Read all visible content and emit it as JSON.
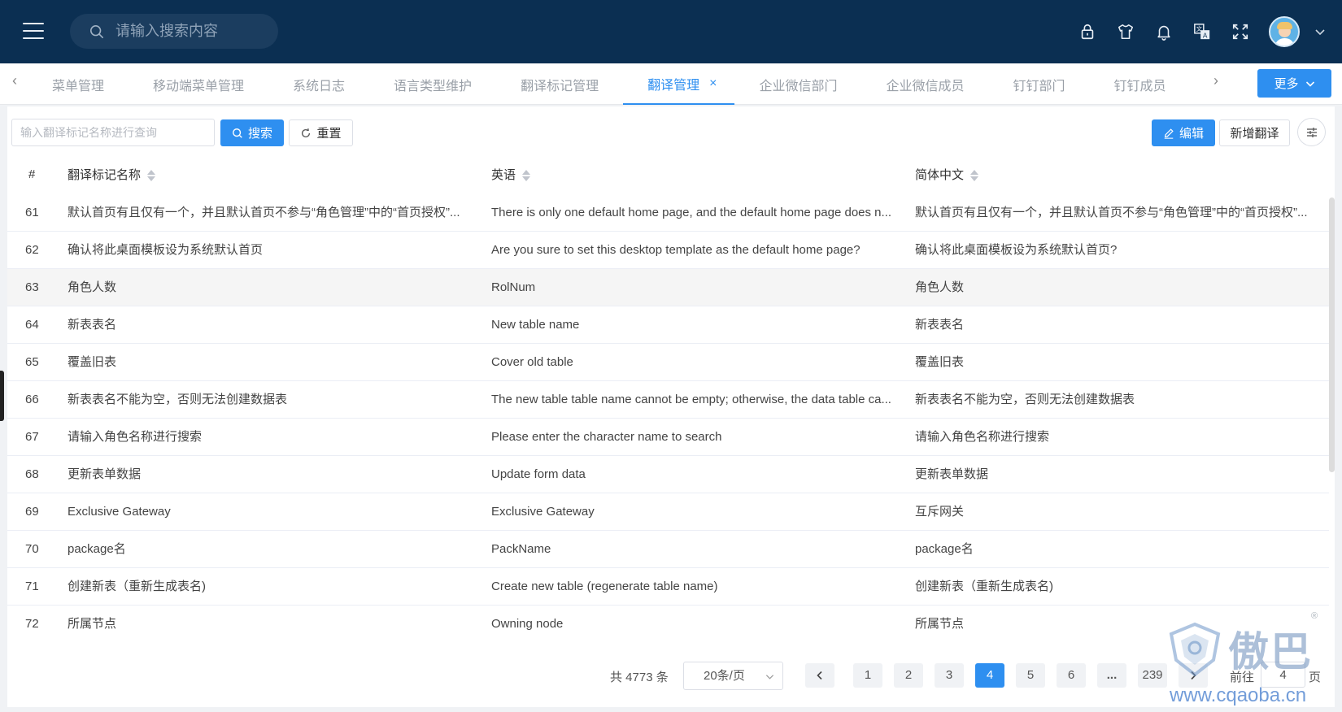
{
  "header": {
    "search_placeholder": "请输入搜索内容",
    "icons": [
      "menu-icon",
      "search-icon",
      "lock-icon",
      "shirt-icon",
      "bell-icon",
      "translate-icon",
      "fullscreen-icon",
      "avatar",
      "chevron-down-icon"
    ]
  },
  "tabs": {
    "items": [
      {
        "label": "菜单管理"
      },
      {
        "label": "移动端菜单管理"
      },
      {
        "label": "系统日志"
      },
      {
        "label": "语言类型维护"
      },
      {
        "label": "翻译标记管理"
      },
      {
        "label": "翻译管理",
        "active": true
      },
      {
        "label": "企业微信部门"
      },
      {
        "label": "企业微信成员"
      },
      {
        "label": "钉钉部门"
      },
      {
        "label": "钉钉成员"
      }
    ],
    "more_label": "更多",
    "close_glyph": "×"
  },
  "toolbar": {
    "query_placeholder": "输入翻译标记名称进行查询",
    "search_label": "搜索",
    "reset_label": "重置",
    "edit_label": "编辑",
    "add_label": "新增翻译"
  },
  "table": {
    "headers": {
      "index": "#",
      "name": "翻译标记名称",
      "english": "英语",
      "chinese": "简体中文"
    },
    "rows": [
      {
        "index": "61",
        "name": "默认首页有且仅有一个，并且默认首页不参与“角色管理”中的“首页授权”...",
        "english": "There is only one default home page, and the default home page does n...",
        "chinese": "默认首页有且仅有一个，并且默认首页不参与“角色管理”中的“首页授权”..."
      },
      {
        "index": "62",
        "name": "确认将此桌面模板设为系统默认首页",
        "english": "Are you sure to set this desktop template as the default home page?",
        "chinese": "确认将此桌面模板设为系统默认首页?"
      },
      {
        "index": "63",
        "name": "角色人数",
        "english": "RolNum",
        "chinese": "角色人数",
        "highlighted": true
      },
      {
        "index": "64",
        "name": "新表表名",
        "english": "New table name",
        "chinese": "新表表名"
      },
      {
        "index": "65",
        "name": "覆盖旧表",
        "english": "Cover old table",
        "chinese": "覆盖旧表"
      },
      {
        "index": "66",
        "name": "新表表名不能为空，否则无法创建数据表",
        "english": "The new table table name cannot be empty; otherwise, the data table ca...",
        "chinese": "新表表名不能为空，否则无法创建数据表"
      },
      {
        "index": "67",
        "name": "请输入角色名称进行搜索",
        "english": "Please enter the character name to search",
        "chinese": "请输入角色名称进行搜索"
      },
      {
        "index": "68",
        "name": "更新表单数据",
        "english": "Update form data",
        "chinese": "更新表单数据"
      },
      {
        "index": "69",
        "name": "Exclusive Gateway",
        "english": "Exclusive Gateway",
        "chinese": "互斥网关"
      },
      {
        "index": "70",
        "name": "package名",
        "english": "PackName",
        "chinese": "package名"
      },
      {
        "index": "71",
        "name": "创建新表（重新生成表名)",
        "english": "Create new table (regenerate table name)",
        "chinese": "创建新表（重新生成表名)"
      },
      {
        "index": "72",
        "name": "所属节点",
        "english": "Owning node",
        "chinese": "所属节点"
      }
    ]
  },
  "pagination": {
    "total_text": "共 4773 条",
    "page_size": "20条/页",
    "pages": [
      "1",
      "2",
      "3",
      "4",
      "5",
      "6",
      "...",
      "239"
    ],
    "current": "4",
    "goto_prefix": "前往",
    "goto_value": "4",
    "goto_suffix": "页"
  },
  "watermark": {
    "brand": "傲巴",
    "url": "www.cqaoba.cn",
    "reg": "®"
  },
  "colors": {
    "topbar": "#0b2f52",
    "accent": "#2e8ff0",
    "row_highlight": "#f5f5f5"
  }
}
